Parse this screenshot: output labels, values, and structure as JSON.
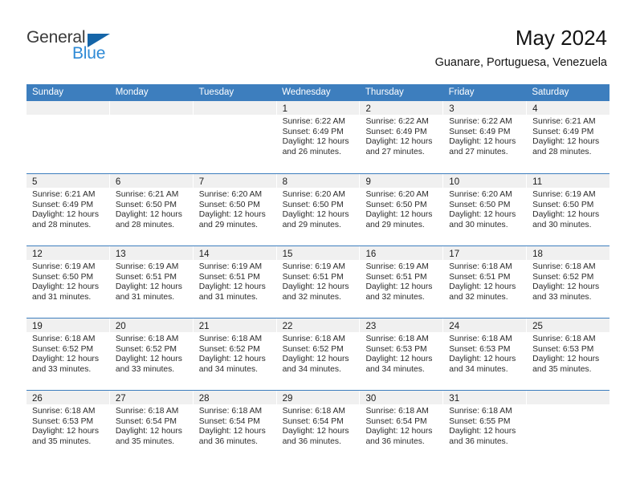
{
  "brand": {
    "name_part1": "General",
    "name_part2": "Blue",
    "triangle_icon": "brand-triangle-icon"
  },
  "header": {
    "title": "May 2024",
    "subtitle": "Guanare, Portuguesa, Venezuela"
  },
  "calendar": {
    "weekday_headers": [
      "Sunday",
      "Monday",
      "Tuesday",
      "Wednesday",
      "Thursday",
      "Friday",
      "Saturday"
    ],
    "colors": {
      "header_blue": "#3d7ebe",
      "daynum_band": "#f0f0f0",
      "brand_blue": "#2e8ad6",
      "brand_dark": "#3a3a3a"
    },
    "weeks": [
      [
        {
          "empty": true
        },
        {
          "empty": true
        },
        {
          "empty": true
        },
        {
          "day": "1",
          "sunrise": "Sunrise: 6:22 AM",
          "sunset": "Sunset: 6:49 PM",
          "daylight1": "Daylight: 12 hours",
          "daylight2": "and 26 minutes."
        },
        {
          "day": "2",
          "sunrise": "Sunrise: 6:22 AM",
          "sunset": "Sunset: 6:49 PM",
          "daylight1": "Daylight: 12 hours",
          "daylight2": "and 27 minutes."
        },
        {
          "day": "3",
          "sunrise": "Sunrise: 6:22 AM",
          "sunset": "Sunset: 6:49 PM",
          "daylight1": "Daylight: 12 hours",
          "daylight2": "and 27 minutes."
        },
        {
          "day": "4",
          "sunrise": "Sunrise: 6:21 AM",
          "sunset": "Sunset: 6:49 PM",
          "daylight1": "Daylight: 12 hours",
          "daylight2": "and 28 minutes."
        }
      ],
      [
        {
          "day": "5",
          "sunrise": "Sunrise: 6:21 AM",
          "sunset": "Sunset: 6:49 PM",
          "daylight1": "Daylight: 12 hours",
          "daylight2": "and 28 minutes."
        },
        {
          "day": "6",
          "sunrise": "Sunrise: 6:21 AM",
          "sunset": "Sunset: 6:50 PM",
          "daylight1": "Daylight: 12 hours",
          "daylight2": "and 28 minutes."
        },
        {
          "day": "7",
          "sunrise": "Sunrise: 6:20 AM",
          "sunset": "Sunset: 6:50 PM",
          "daylight1": "Daylight: 12 hours",
          "daylight2": "and 29 minutes."
        },
        {
          "day": "8",
          "sunrise": "Sunrise: 6:20 AM",
          "sunset": "Sunset: 6:50 PM",
          "daylight1": "Daylight: 12 hours",
          "daylight2": "and 29 minutes."
        },
        {
          "day": "9",
          "sunrise": "Sunrise: 6:20 AM",
          "sunset": "Sunset: 6:50 PM",
          "daylight1": "Daylight: 12 hours",
          "daylight2": "and 29 minutes."
        },
        {
          "day": "10",
          "sunrise": "Sunrise: 6:20 AM",
          "sunset": "Sunset: 6:50 PM",
          "daylight1": "Daylight: 12 hours",
          "daylight2": "and 30 minutes."
        },
        {
          "day": "11",
          "sunrise": "Sunrise: 6:19 AM",
          "sunset": "Sunset: 6:50 PM",
          "daylight1": "Daylight: 12 hours",
          "daylight2": "and 30 minutes."
        }
      ],
      [
        {
          "day": "12",
          "sunrise": "Sunrise: 6:19 AM",
          "sunset": "Sunset: 6:50 PM",
          "daylight1": "Daylight: 12 hours",
          "daylight2": "and 31 minutes."
        },
        {
          "day": "13",
          "sunrise": "Sunrise: 6:19 AM",
          "sunset": "Sunset: 6:51 PM",
          "daylight1": "Daylight: 12 hours",
          "daylight2": "and 31 minutes."
        },
        {
          "day": "14",
          "sunrise": "Sunrise: 6:19 AM",
          "sunset": "Sunset: 6:51 PM",
          "daylight1": "Daylight: 12 hours",
          "daylight2": "and 31 minutes."
        },
        {
          "day": "15",
          "sunrise": "Sunrise: 6:19 AM",
          "sunset": "Sunset: 6:51 PM",
          "daylight1": "Daylight: 12 hours",
          "daylight2": "and 32 minutes."
        },
        {
          "day": "16",
          "sunrise": "Sunrise: 6:19 AM",
          "sunset": "Sunset: 6:51 PM",
          "daylight1": "Daylight: 12 hours",
          "daylight2": "and 32 minutes."
        },
        {
          "day": "17",
          "sunrise": "Sunrise: 6:18 AM",
          "sunset": "Sunset: 6:51 PM",
          "daylight1": "Daylight: 12 hours",
          "daylight2": "and 32 minutes."
        },
        {
          "day": "18",
          "sunrise": "Sunrise: 6:18 AM",
          "sunset": "Sunset: 6:52 PM",
          "daylight1": "Daylight: 12 hours",
          "daylight2": "and 33 minutes."
        }
      ],
      [
        {
          "day": "19",
          "sunrise": "Sunrise: 6:18 AM",
          "sunset": "Sunset: 6:52 PM",
          "daylight1": "Daylight: 12 hours",
          "daylight2": "and 33 minutes."
        },
        {
          "day": "20",
          "sunrise": "Sunrise: 6:18 AM",
          "sunset": "Sunset: 6:52 PM",
          "daylight1": "Daylight: 12 hours",
          "daylight2": "and 33 minutes."
        },
        {
          "day": "21",
          "sunrise": "Sunrise: 6:18 AM",
          "sunset": "Sunset: 6:52 PM",
          "daylight1": "Daylight: 12 hours",
          "daylight2": "and 34 minutes."
        },
        {
          "day": "22",
          "sunrise": "Sunrise: 6:18 AM",
          "sunset": "Sunset: 6:52 PM",
          "daylight1": "Daylight: 12 hours",
          "daylight2": "and 34 minutes."
        },
        {
          "day": "23",
          "sunrise": "Sunrise: 6:18 AM",
          "sunset": "Sunset: 6:53 PM",
          "daylight1": "Daylight: 12 hours",
          "daylight2": "and 34 minutes."
        },
        {
          "day": "24",
          "sunrise": "Sunrise: 6:18 AM",
          "sunset": "Sunset: 6:53 PM",
          "daylight1": "Daylight: 12 hours",
          "daylight2": "and 34 minutes."
        },
        {
          "day": "25",
          "sunrise": "Sunrise: 6:18 AM",
          "sunset": "Sunset: 6:53 PM",
          "daylight1": "Daylight: 12 hours",
          "daylight2": "and 35 minutes."
        }
      ],
      [
        {
          "day": "26",
          "sunrise": "Sunrise: 6:18 AM",
          "sunset": "Sunset: 6:53 PM",
          "daylight1": "Daylight: 12 hours",
          "daylight2": "and 35 minutes."
        },
        {
          "day": "27",
          "sunrise": "Sunrise: 6:18 AM",
          "sunset": "Sunset: 6:54 PM",
          "daylight1": "Daylight: 12 hours",
          "daylight2": "and 35 minutes."
        },
        {
          "day": "28",
          "sunrise": "Sunrise: 6:18 AM",
          "sunset": "Sunset: 6:54 PM",
          "daylight1": "Daylight: 12 hours",
          "daylight2": "and 36 minutes."
        },
        {
          "day": "29",
          "sunrise": "Sunrise: 6:18 AM",
          "sunset": "Sunset: 6:54 PM",
          "daylight1": "Daylight: 12 hours",
          "daylight2": "and 36 minutes."
        },
        {
          "day": "30",
          "sunrise": "Sunrise: 6:18 AM",
          "sunset": "Sunset: 6:54 PM",
          "daylight1": "Daylight: 12 hours",
          "daylight2": "and 36 minutes."
        },
        {
          "day": "31",
          "sunrise": "Sunrise: 6:18 AM",
          "sunset": "Sunset: 6:55 PM",
          "daylight1": "Daylight: 12 hours",
          "daylight2": "and 36 minutes."
        },
        {
          "empty": true
        }
      ]
    ]
  }
}
